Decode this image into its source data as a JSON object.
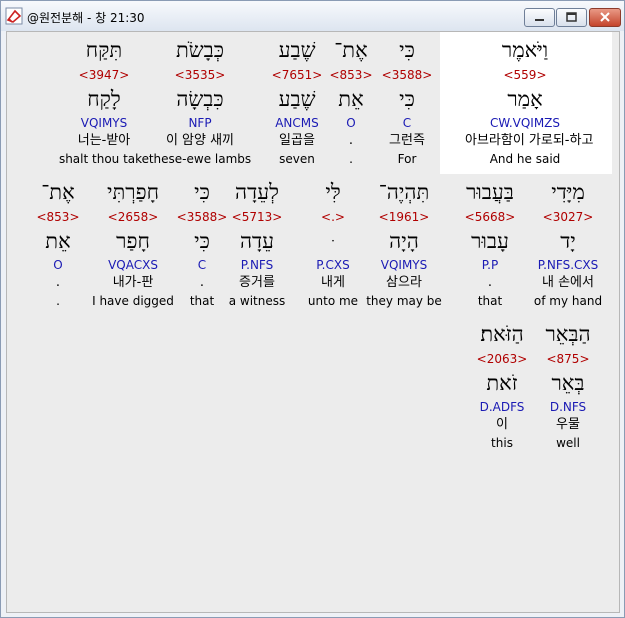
{
  "window": {
    "title": "@원전분해 - 창 21:30"
  },
  "rows": [
    [
      {
        "heb": "וַיֹּאמֶר",
        "num": "<559>",
        "lemma": "אָמַר",
        "parse": "CW.VQIMZS",
        "ko": "아브라함이 가로되-하고",
        "en": "And he said",
        "highlight": true
      },
      {
        "heb": "כִּי",
        "num": "<3588>",
        "lemma": "כִּי",
        "parse": "C",
        "ko": "그런즉",
        "en": "For"
      },
      {
        "heb": "אֶת־",
        "num": "<853>",
        "lemma": "אֵת",
        "parse": "O",
        "ko": ".",
        "en": "."
      },
      {
        "heb": "שֶׁבַע",
        "num": "<7651>",
        "lemma": "שֶׁבַע",
        "parse": "ANCMS",
        "ko": "일곱을",
        "en": "seven"
      },
      {
        "heb": "כְּבָשֹׂת",
        "num": "<3535>",
        "lemma": "כִּבְשָׂה",
        "parse": "NFP",
        "ko": "이 암양 새끼",
        "en": "these-ewe lambs"
      },
      {
        "heb": "תִּקַּח",
        "num": "<3947>",
        "lemma": "לָקַח",
        "parse": "VQIMYS",
        "ko": "너는-받아",
        "en": "shalt thou take"
      }
    ],
    [
      {
        "heb": "מִיָּדִי",
        "num": "<3027>",
        "lemma": "יָד",
        "parse": "P.NFS.CXS",
        "ko": "내 손에서",
        "en": "of my hand"
      },
      {
        "heb": "בַּעֲבוּר",
        "num": "<5668>",
        "lemma": "עָבוּר",
        "parse": "P.P",
        "ko": ".",
        "en": "that"
      },
      {
        "heb": "תִּהְיֶה־",
        "num": "<1961>",
        "lemma": "הָיָה",
        "parse": "VQIMYS",
        "ko": "삼으라",
        "en": "they may be"
      },
      {
        "heb": "לִּי",
        "num": "<.>",
        "lemma": "ּ",
        "parse": "P.CXS",
        "ko": "내게",
        "en": "unto me"
      },
      {
        "heb": "לְעֵדָה",
        "num": "<5713>",
        "lemma": "עֵדָה",
        "parse": "P.NFS",
        "ko": "증거를",
        "en": "a witness"
      },
      {
        "heb": "כִּי",
        "num": "<3588>",
        "lemma": "כִּי",
        "parse": "C",
        "ko": ".",
        "en": "that"
      },
      {
        "heb": "חָפַרְתִּי",
        "num": "<2658>",
        "lemma": "חָפַר",
        "parse": "VQACXS",
        "ko": "내가-판",
        "en": "I have digged"
      },
      {
        "heb": "אֶת־",
        "num": "<853>",
        "lemma": "אֵת",
        "parse": "O",
        "ko": ".",
        "en": "."
      }
    ],
    [
      {
        "heb": "הַבְּאֵר",
        "num": "<875>",
        "lemma": "בְּאֵר",
        "parse": "D.NFS",
        "ko": "우물",
        "en": "well"
      },
      {
        "heb": "הַזֹּאת׃",
        "num": "<2063>",
        "lemma": "זֹאת",
        "parse": "D.ADFS",
        "ko": "이",
        "en": "this"
      }
    ]
  ]
}
